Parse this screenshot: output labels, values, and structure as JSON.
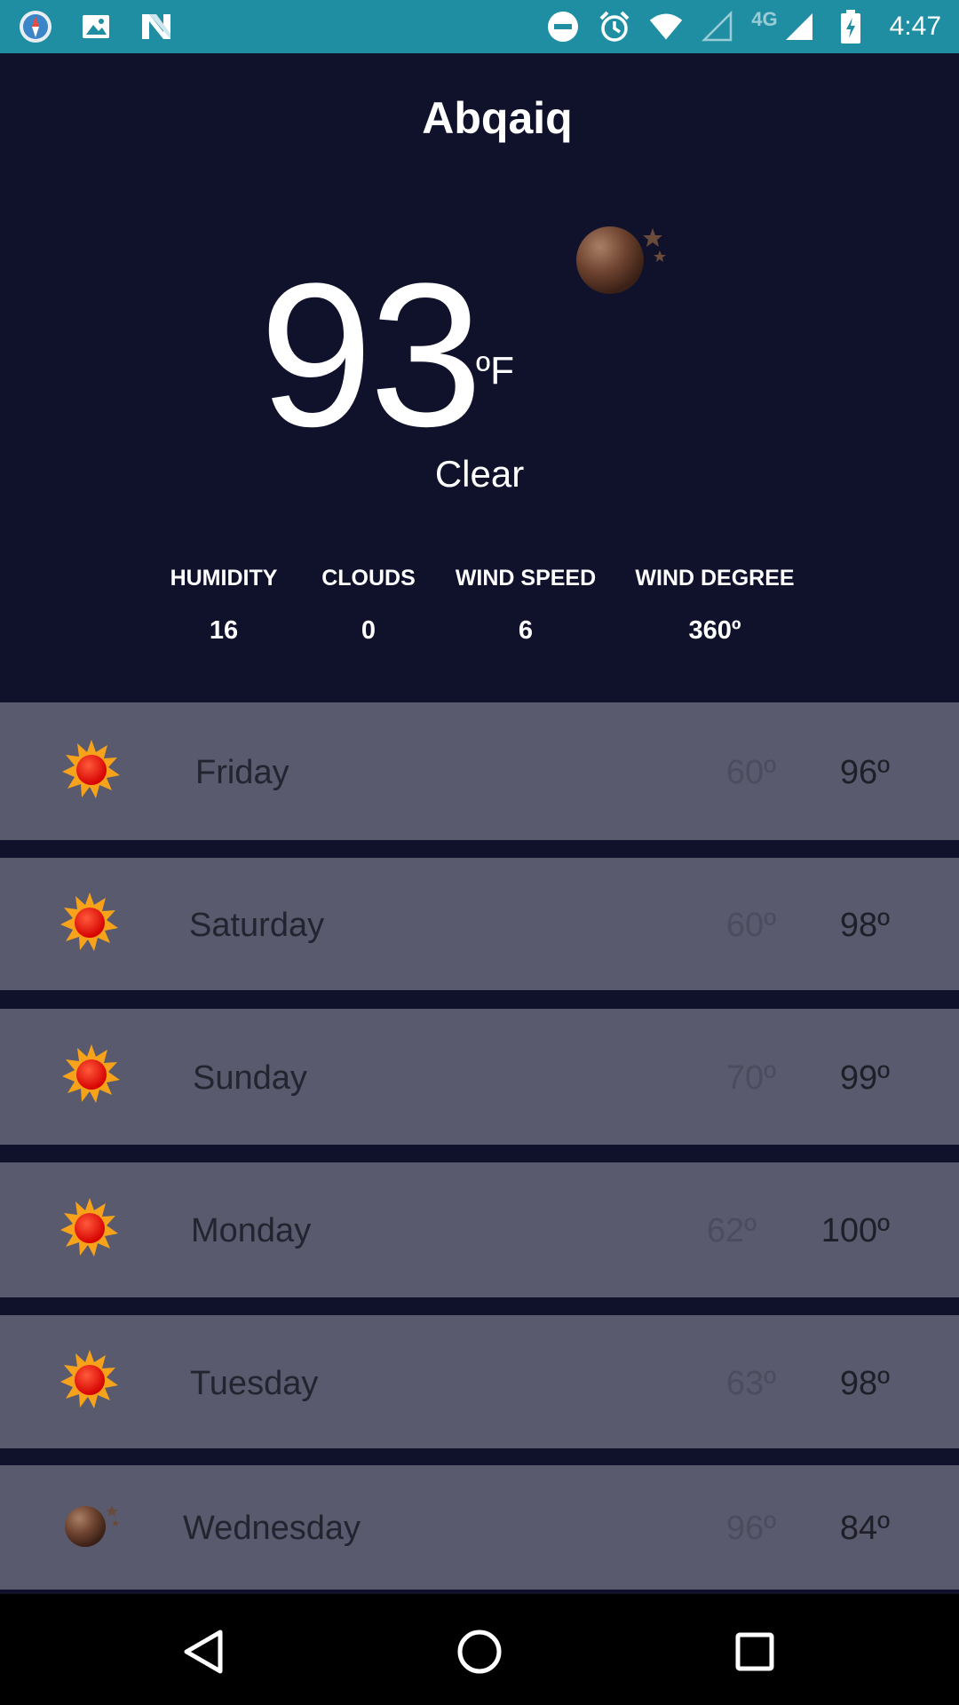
{
  "status_bar": {
    "time": "4:47",
    "network": "4G",
    "icons_left": [
      "compass-icon",
      "image-icon",
      "n-logo-icon"
    ],
    "icons_right": [
      "dnd-icon",
      "alarm-icon",
      "wifi-icon",
      "signal-empty-icon",
      "signal-full-icon",
      "battery-charging-icon"
    ]
  },
  "current": {
    "city": "Abqaiq",
    "temperature": "93",
    "unit": "ºF",
    "condition": "Clear",
    "icon": "moon-icon"
  },
  "stats": [
    {
      "label": "HUMIDITY",
      "value": "16"
    },
    {
      "label": "CLOUDS",
      "value": "0"
    },
    {
      "label": "WIND SPEED",
      "value": "6"
    },
    {
      "label": "WIND DEGREE",
      "value": "360º"
    }
  ],
  "forecast": [
    {
      "day": "Friday",
      "low": "60º",
      "high": "96º",
      "icon": "sun-icon"
    },
    {
      "day": "Saturday",
      "low": "60º",
      "high": "98º",
      "icon": "sun-icon"
    },
    {
      "day": "Sunday",
      "low": "70º",
      "high": "99º",
      "icon": "sun-icon"
    },
    {
      "day": "Monday",
      "low": "62º",
      "high": "100º",
      "icon": "sun-icon"
    },
    {
      "day": "Tuesday",
      "low": "63º",
      "high": "98º",
      "icon": "sun-icon"
    },
    {
      "day": "Wednesday",
      "low": "96º",
      "high": "84º",
      "icon": "moon-icon"
    }
  ],
  "nav": [
    "back-icon",
    "home-icon",
    "recents-icon"
  ]
}
